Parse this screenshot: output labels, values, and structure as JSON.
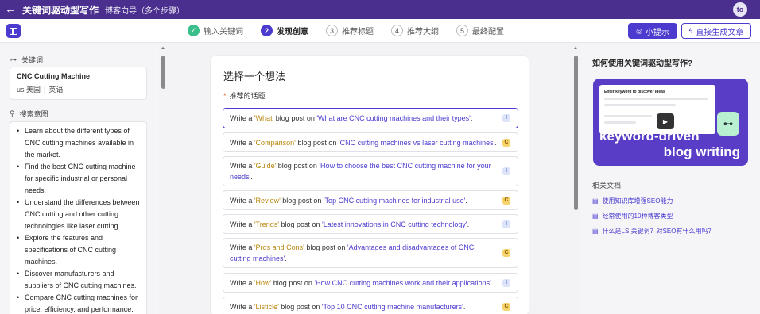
{
  "app": {
    "title": "关键词驱动型写作",
    "subtitle": "博客向导（多个步骤）",
    "avatar": "to"
  },
  "steps": [
    {
      "num": "✓",
      "label": "输入关键词",
      "state": "done"
    },
    {
      "num": "2",
      "label": "发现创意",
      "state": "active"
    },
    {
      "num": "3",
      "label": "推荐标题",
      "state": "todo"
    },
    {
      "num": "4",
      "label": "推荐大纲",
      "state": "todo"
    },
    {
      "num": "5",
      "label": "最终配置",
      "state": "todo"
    }
  ],
  "toolbar": {
    "tips_label": "小提示",
    "generate_label": "直接生成文章"
  },
  "left": {
    "keyword_section": "关键词",
    "keyword": "CNC Cutting Machine",
    "country_code": "us",
    "country": "美国",
    "language": "英语",
    "intent_section": "搜索意图",
    "intents": [
      "Learn about the different types of CNC cutting machines available in the market.",
      "Find the best CNC cutting machine for specific industrial or personal needs.",
      "Understand the differences between CNC cutting and other cutting technologies like laser cutting.",
      "Explore the features and specifications of CNC cutting machines.",
      "Discover manufacturers and suppliers of CNC cutting machines.",
      "Compare CNC cutting machines for price, efficiency, and performance."
    ]
  },
  "center": {
    "heading": "选择一个想法",
    "recommended_label": "推荐的话题",
    "prefix": "Write a ",
    "middle": " blog post on ",
    "ideas": [
      {
        "kind": "'What'",
        "topic": "'What are CNC cutting machines and their types'",
        "badge": "I"
      },
      {
        "kind": "'Comparison'",
        "topic": "'CNC cutting machines vs laser cutting machines'",
        "badge": "C"
      },
      {
        "kind": "'Guide'",
        "topic": "'How to choose the best CNC cutting machine for your needs'",
        "badge": "I"
      },
      {
        "kind": "'Review'",
        "topic": "'Top CNC cutting machines for industrial use'",
        "badge": "C"
      },
      {
        "kind": "'Trends'",
        "topic": "'Latest innovations in CNC cutting technology'",
        "badge": "I"
      },
      {
        "kind": "'Pros and Cons'",
        "topic": "'Advantages and disadvantages of CNC cutting machines'",
        "badge": "C"
      },
      {
        "kind": "'How'",
        "topic": "'How CNC cutting machines work and their applications'",
        "badge": "I"
      },
      {
        "kind": "'Listicle'",
        "topic": "'Top 10 CNC cutting machine manufacturers'",
        "badge": "C"
      }
    ]
  },
  "right": {
    "heading": "如何使用关键词驱动型写作?",
    "video": {
      "shot_title": "Enter keyword to discover ideas",
      "line1": "keyword-driven",
      "line2": "blog writing",
      "play_icon": "play-icon",
      "key_icon": "key-icon"
    },
    "docs_title": "相关文档",
    "docs": [
      "使用知识库增强SEO能力",
      "经常使用的10种博客类型",
      "什么是LSI关键词？对SEO有什么用吗？"
    ]
  },
  "colors": {
    "topbar": "#4a2f8f",
    "accent": "#4b3bcf",
    "done": "#3bbf8a",
    "badge_c": "#f6d36b",
    "badge_i": "#dde4f9"
  }
}
